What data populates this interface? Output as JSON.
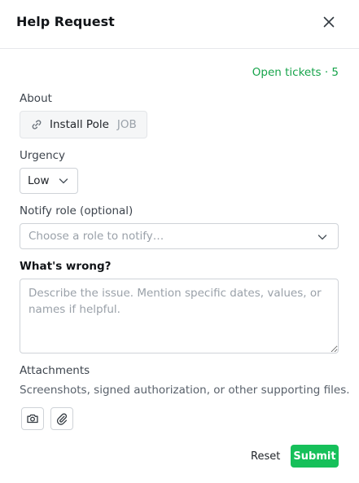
{
  "header": {
    "title": "Help Request",
    "close_icon": "close-icon"
  },
  "open_tickets": "Open tickets · 5",
  "about": {
    "label": "About",
    "name": "Install Pole",
    "type": "JOB",
    "icon": "link-icon"
  },
  "urgency": {
    "label": "Urgency",
    "value": "Low"
  },
  "notify": {
    "label": "Notify role (optional)",
    "placeholder": "Choose a role to notify…"
  },
  "issue": {
    "label": "What's wrong?",
    "placeholder": "Describe the issue. Mention specific dates, values, or names if helpful.",
    "value": ""
  },
  "attachments": {
    "label": "Attachments",
    "hint": "Screenshots, signed authorization, or other supporting files.",
    "camera_icon": "camera-icon",
    "paperclip_icon": "paperclip-icon"
  },
  "actions": {
    "reset_label": "Reset",
    "submit_label": "Submit"
  },
  "colors": {
    "accent": "#16c05a",
    "tickets": "#16a34a"
  }
}
